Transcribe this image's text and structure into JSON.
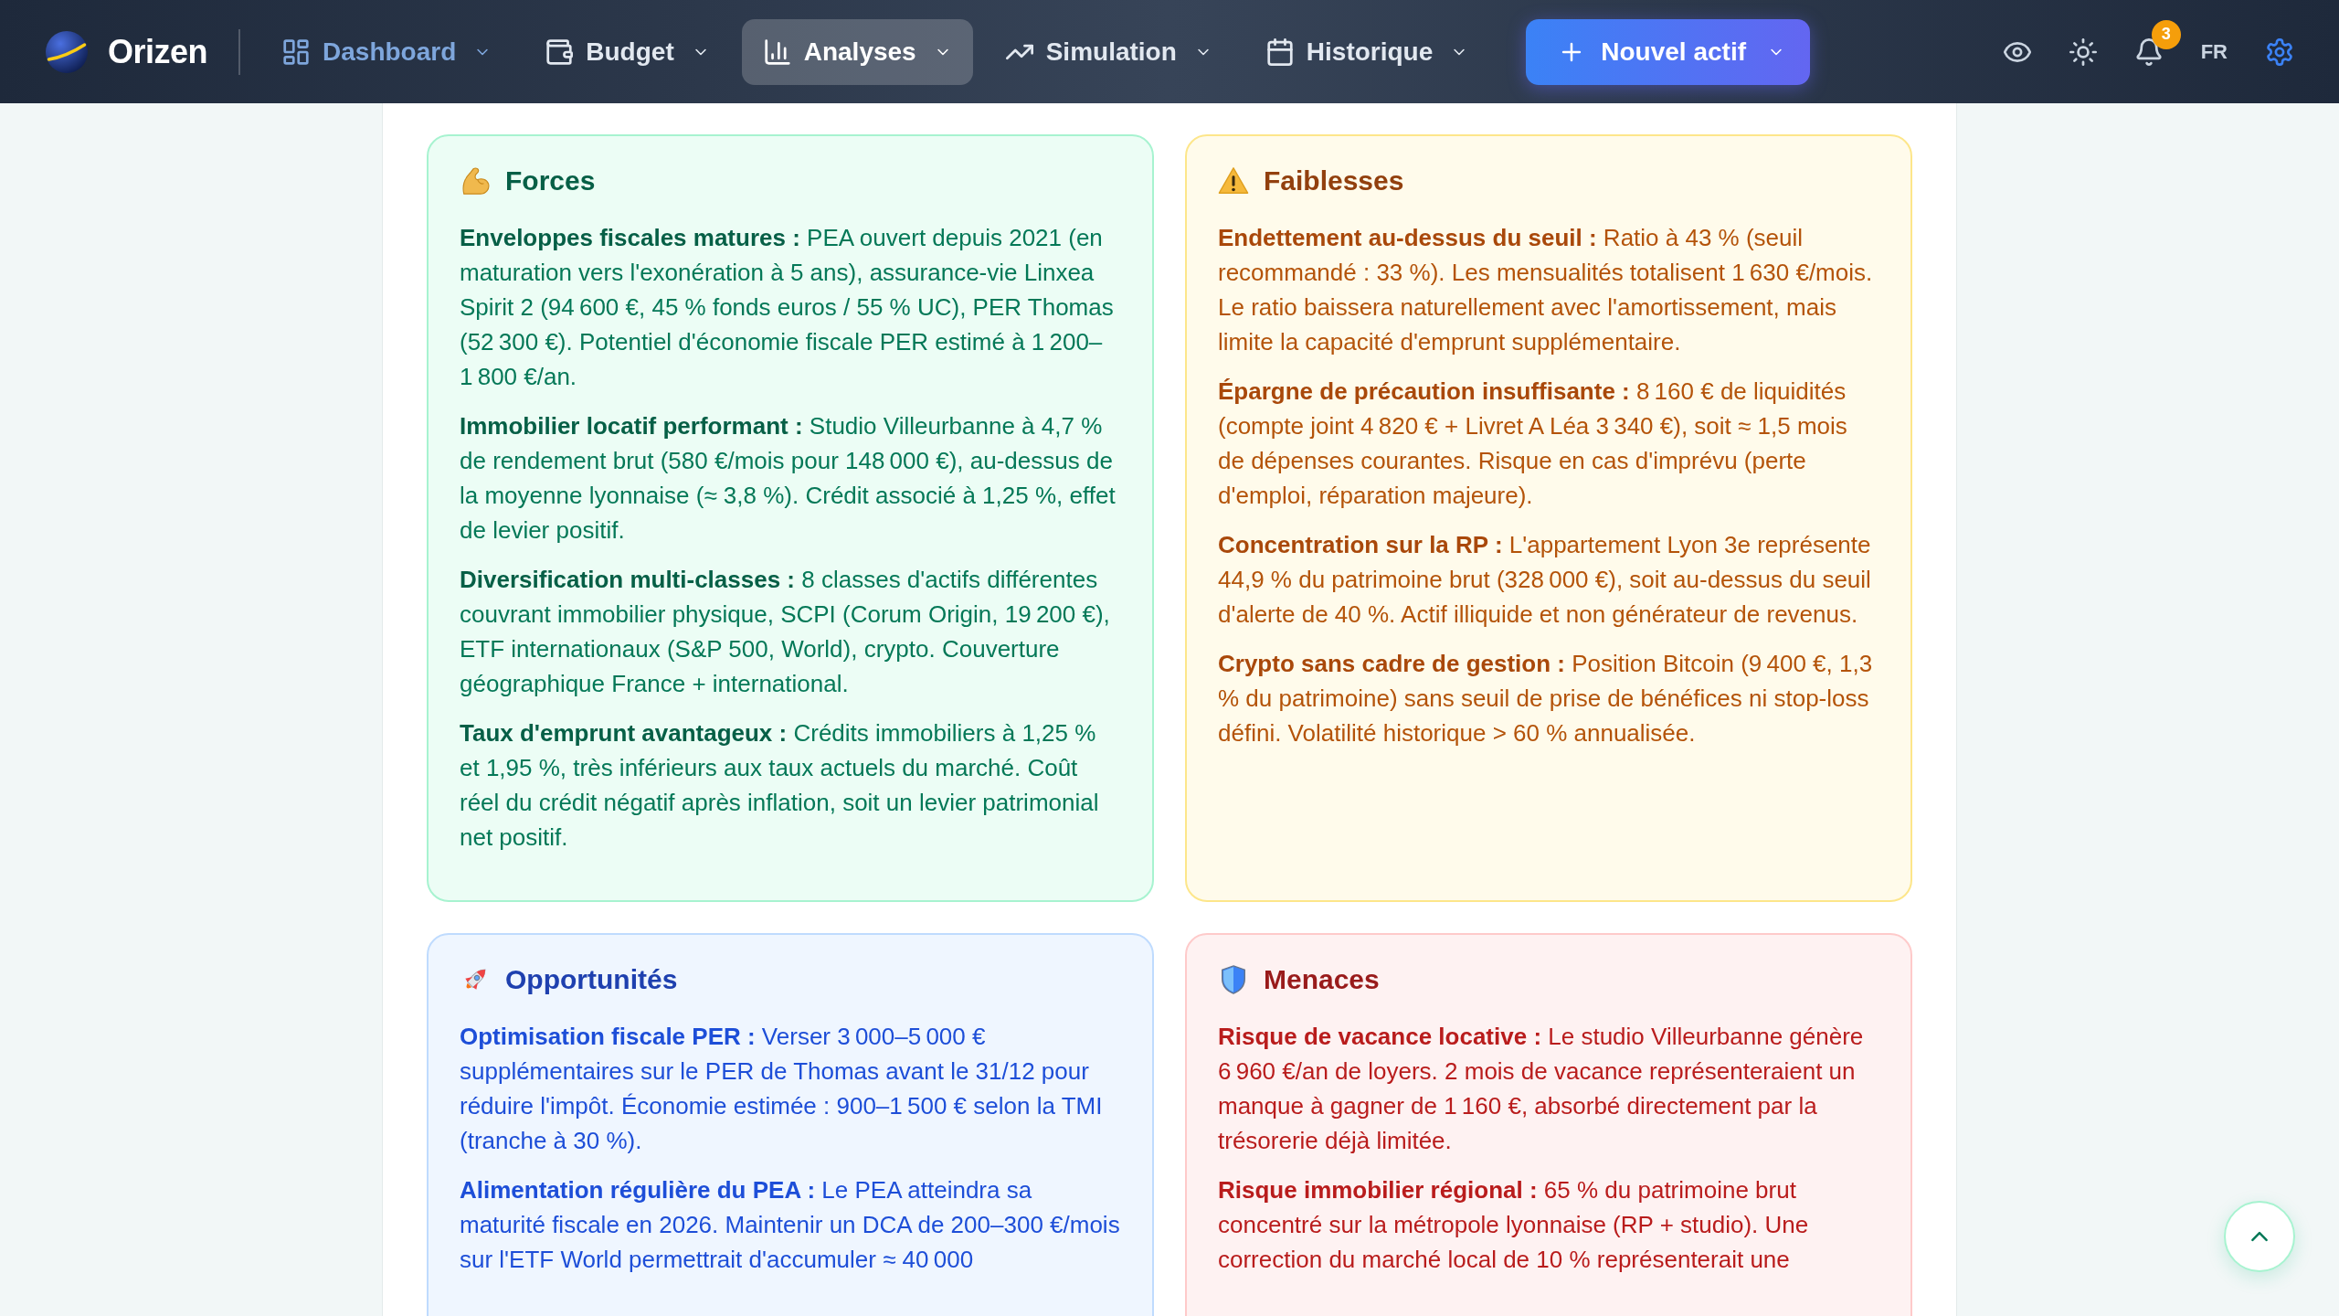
{
  "header": {
    "app_name": "Orizen",
    "nav_items": [
      {
        "label": "Dashboard",
        "selected": false,
        "highlighted": true
      },
      {
        "label": "Budget",
        "selected": false,
        "highlighted": false
      },
      {
        "label": "Analyses",
        "selected": true,
        "highlighted": false
      },
      {
        "label": "Simulation",
        "selected": false,
        "highlighted": false
      },
      {
        "label": "Historique",
        "selected": false,
        "highlighted": false
      }
    ],
    "new_asset_button": {
      "label": "Nouvel actif"
    },
    "notifications": {
      "count": "3"
    },
    "language": "FR"
  },
  "swot": [
    {
      "kind": "strengths",
      "title": "Forces",
      "points": [
        "**Enveloppes fiscales matures :** PEA ouvert depuis 2021 (en maturation vers l'exonération à 5 ans), assurance-vie Linxea Spirit 2 (94 600 €, 45 % fonds euros / 55 % UC), PER Thomas (52 300 €). Potentiel d'économie fiscale PER estimé à 1 200–1 800 €/an.",
        "**Immobilier locatif performant :** Studio Villeurbanne à 4,7 % de rendement brut (580 €/mois pour 148 000 €), au-dessus de la moyenne lyonnaise (≈ 3,8 %). Crédit associé à 1,25 %, effet de levier positif.",
        "**Diversification multi-classes :** 8 classes d'actifs différentes couvrant immobilier physique, SCPI (Corum Origin, 19 200 €), ETF internationaux (S&P 500, World), crypto. Couverture géographique France + international.",
        "**Taux d'emprunt avantageux :** Crédits immobiliers à 1,25 % et 1,95 %, très inférieurs aux taux actuels du marché. Coût réel du crédit négatif après inflation, soit un levier patrimonial net positif."
      ]
    },
    {
      "kind": "weaknesses",
      "title": "Faiblesses",
      "points": [
        "**Endettement au-dessus du seuil :** Ratio à 43 % (seuil recommandé : 33 %). Les mensualités totalisent 1 630 €/mois. Le ratio baissera naturellement avec l'amortissement, mais limite la capacité d'emprunt supplémentaire.",
        "**Épargne de précaution insuffisante :** 8 160 € de liquidités (compte joint 4 820 € + Livret A Léa 3 340 €), soit ≈ 1,5 mois de dépenses courantes. Risque en cas d'imprévu (perte d'emploi, réparation majeure).",
        "**Concentration sur la RP :** L'appartement Lyon 3e représente 44,9 % du patrimoine brut (328 000 €), soit au-dessus du seuil d'alerte de 40 %. Actif illiquide et non générateur de revenus.",
        "**Crypto sans cadre de gestion :** Position Bitcoin (9 400 €, 1,3 % du patrimoine) sans seuil de prise de bénéfices ni stop-loss défini. Volatilité historique > 60 % annualisée."
      ]
    },
    {
      "kind": "opportunities",
      "title": "Opportunités",
      "points": [
        "**Optimisation fiscale PER :** Verser 3 000–5 000 € supplémentaires sur le PER de Thomas avant le 31/12 pour réduire l'impôt. Économie estimée : 900–1 500 € selon la TMI (tranche à 30 %).",
        "**Alimentation régulière du PEA :** Le PEA atteindra sa maturité fiscale en 2026. Maintenir un DCA de 200–300 €/mois sur l'ETF World permettrait d'accumuler ≈ 40 000"
      ]
    },
    {
      "kind": "threats",
      "title": "Menaces",
      "points": [
        "**Risque de vacance locative :** Le studio Villeurbanne génère 6 960 €/an de loyers. 2 mois de vacance représenteraient un manque à gagner de 1 160 €, absorbé directement par la trésorerie déjà limitée.",
        "**Risque immobilier régional :** 65 % du patrimoine brut concentré sur la métropole lyonnaise (RP + studio). Une correction du marché local de 10 % représenterait une"
      ]
    }
  ]
}
